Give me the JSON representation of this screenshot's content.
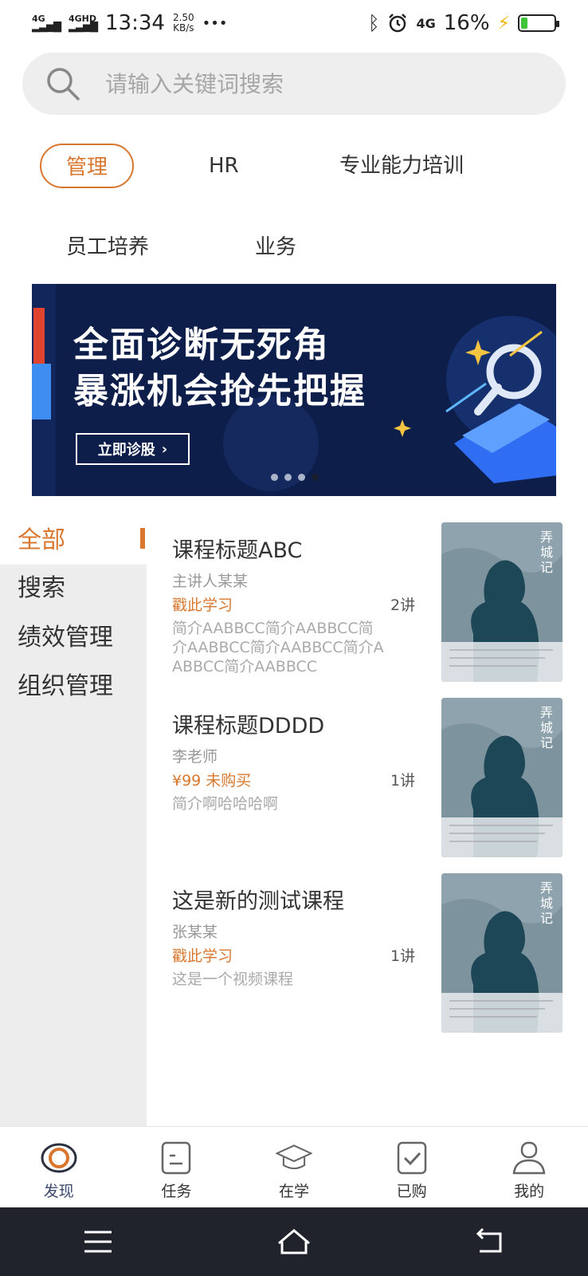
{
  "status_bar": {
    "signal_1": "4G",
    "signal_2": "4GHD",
    "time": "13:34",
    "speed_value": "2.50",
    "speed_unit": "KB/s",
    "more": "•••",
    "network": "4G",
    "battery_percent": "16%",
    "battery_level": 0.16
  },
  "search": {
    "placeholder": "请输入关键词搜索"
  },
  "categories": [
    {
      "label": "管理",
      "active": true
    },
    {
      "label": "HR"
    },
    {
      "label": "专业能力培训"
    },
    {
      "label": "员工培养"
    },
    {
      "label": "业务"
    }
  ],
  "banner": {
    "line1": "全面诊断无死角",
    "line2": "暴涨机会抢先把握",
    "button": "立即诊股",
    "button_arrow": "›",
    "page_count": 4,
    "active_page": 4
  },
  "sidebar": {
    "items": [
      {
        "label": "全部",
        "active": true
      },
      {
        "label": "搜索"
      },
      {
        "label": "绩效管理"
      },
      {
        "label": "组织管理"
      }
    ]
  },
  "courses": [
    {
      "title": "课程标题ABC",
      "teacher": "主讲人某某",
      "status": "戳此学习",
      "lessons": "2讲",
      "desc": "简介AABBCC简介AABBCC简介AABBCC简介AABBCC简介AABBCC简介AABBCC",
      "cover_title": "弄城记"
    },
    {
      "title": "课程标题DDDD",
      "teacher": "李老师",
      "status": "¥99 未购买",
      "lessons": "1讲",
      "desc": "简介啊哈哈哈啊",
      "cover_title": "弄城记"
    },
    {
      "title": "这是新的测试课程",
      "teacher": "张某某",
      "status": "戳此学习",
      "lessons": "1讲",
      "desc": "这是一个视频课程",
      "cover_title": "弄城记"
    }
  ],
  "tabbar": {
    "items": [
      {
        "label": "发现",
        "icon": "eye-icon",
        "active": true
      },
      {
        "label": "任务",
        "icon": "task-icon"
      },
      {
        "label": "在学",
        "icon": "graduation-cap-icon"
      },
      {
        "label": "已购",
        "icon": "purchased-check-icon"
      },
      {
        "label": "我的",
        "icon": "user-icon"
      }
    ]
  },
  "navbar": {
    "icons": [
      "menu-icon",
      "home-icon",
      "back-icon"
    ]
  },
  "colors": {
    "accent": "#d9772f",
    "banner_bg": "#0d1e4a",
    "tab_active": "#3c4a6e",
    "sidebar_bg": "#ededed"
  }
}
